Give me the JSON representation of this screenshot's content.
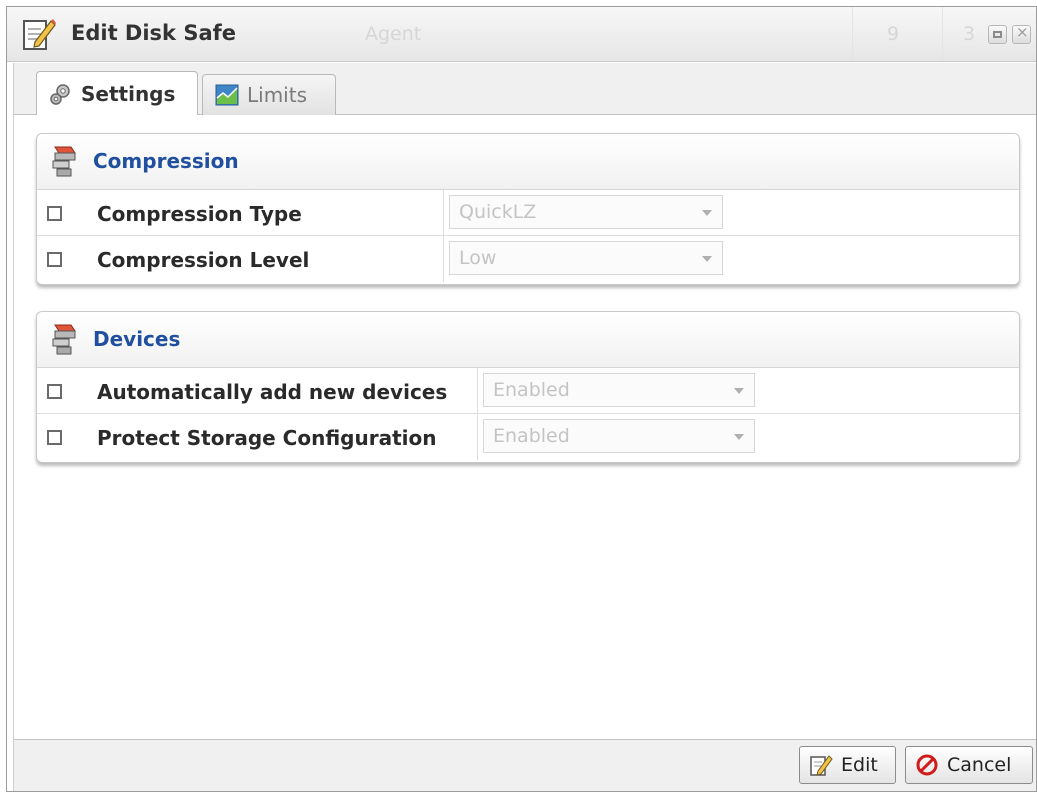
{
  "window": {
    "title": "Edit Disk Safe",
    "background_columns": [
      "Agent",
      "9",
      "3"
    ]
  },
  "tabs": [
    {
      "label": "Settings",
      "icon": "gears-icon",
      "active": true
    },
    {
      "label": "Limits",
      "icon": "chart-icon",
      "active": false
    }
  ],
  "sections": {
    "compression": {
      "title": "Compression",
      "icon": "disk-safe-icon",
      "rows": [
        {
          "label": "Compression Type",
          "value": "QuickLZ",
          "checked": false
        },
        {
          "label": "Compression Level",
          "value": "Low",
          "checked": false
        }
      ]
    },
    "devices": {
      "title": "Devices",
      "icon": "disk-safe-icon",
      "rows": [
        {
          "label": "Automatically add new devices",
          "value": "Enabled",
          "checked": false
        },
        {
          "label": "Protect Storage Configuration",
          "value": "Enabled",
          "checked": false
        }
      ]
    }
  },
  "buttons": {
    "edit": "Edit",
    "cancel": "Cancel"
  },
  "colors": {
    "section_title": "#1f4f9e",
    "cancel_icon": "#d11b1b"
  }
}
